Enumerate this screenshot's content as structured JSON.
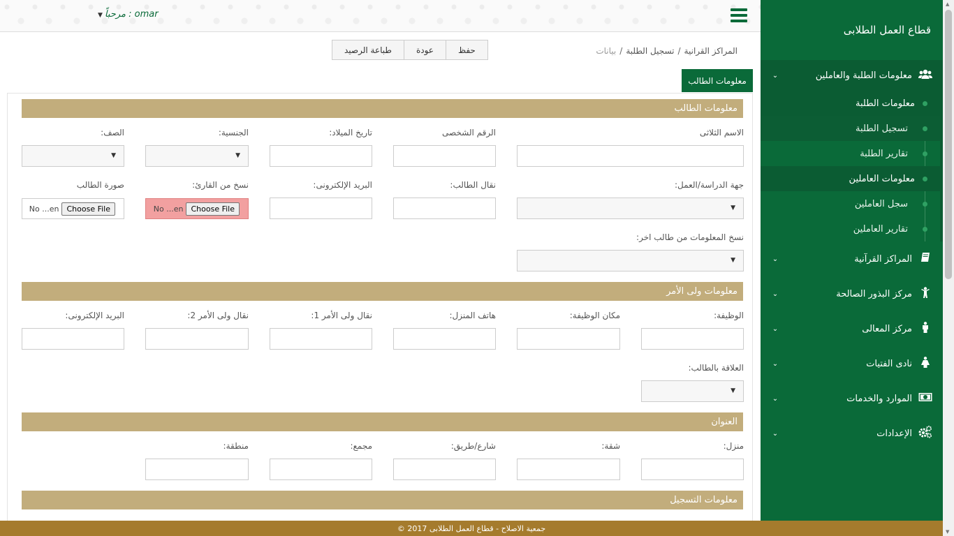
{
  "sidebar": {
    "title": "قطاع العمل الطلابى",
    "group_open": {
      "label": "معلومات الطلبة والعاملين",
      "icon": "users-icon"
    },
    "submenu": [
      {
        "type": "head",
        "label": "معلومات الطلبة"
      },
      {
        "type": "item",
        "label": "تسجيل الطلبة",
        "active": true
      },
      {
        "type": "item",
        "label": "تقارير الطلبة"
      },
      {
        "type": "head",
        "label": "معلومات العاملين"
      },
      {
        "type": "item",
        "label": "سجل العاملين"
      },
      {
        "type": "item",
        "label": "تقارير العاملين"
      }
    ],
    "items": [
      {
        "label": "المراكز القرآنية",
        "icon": "book-icon"
      },
      {
        "label": "مركز البذور الصالحة",
        "icon": "child-icon"
      },
      {
        "label": "مركز المعالى",
        "icon": "male-icon"
      },
      {
        "label": "نادى الفتيات",
        "icon": "female-icon"
      },
      {
        "label": "الموارد والخدمات",
        "icon": "money-icon"
      },
      {
        "label": "الإعدادات",
        "icon": "cogs-icon"
      }
    ]
  },
  "topbar": {
    "welcome": "مرحباً : omar"
  },
  "breadcrumb": {
    "part1": "المراكز القرانية",
    "sep1": "/",
    "part2": "تسجيل الطلبة",
    "sep2": "/",
    "current": "بيانات"
  },
  "toolbar": {
    "save": "حفظ",
    "back": "عودة",
    "print": "طباعة الرصيد"
  },
  "tab": {
    "label": "معلومات الطالب"
  },
  "sections": {
    "student": "معلومات الطالب",
    "guardian": "معلومات ولى الأمر",
    "address": "العنوان",
    "registration": "معلومات التسجيل"
  },
  "student_fields": {
    "full_name": "الاسم الثلاثى",
    "national_id": "الرقم الشخصى",
    "birth_date": "تاريخ الميلاد:",
    "nationality": "الجنسية:",
    "grade": "الصف:",
    "study_place": "جهة الدراسة/العمل:",
    "mobile": "نقال الطالب:",
    "email": "البريد الإلكترونى:",
    "reader_copy": "نسخ من القارئ:",
    "photo": "صورة الطالب",
    "copy_from": "نسخ المعلومات من طالب اخر:",
    "file_button": "Choose File",
    "file_status": "No ...en"
  },
  "guardian_fields": {
    "job": "الوظيفة:",
    "job_place": "مكان الوظيفة:",
    "home_phone": "هاتف المنزل:",
    "mobile1": "نقال ولى الأمر 1:",
    "mobile2": "نقال ولى الأمر 2:",
    "email": "البريد الإلكترونى:",
    "relation": "العلاقة بالطالب:"
  },
  "address_fields": {
    "house": "منزل:",
    "flat": "شقة:",
    "street": "شارع/طريق:",
    "block": "مجمع:",
    "area": "منطقة:"
  },
  "footer": {
    "text": "© 2017 جمعية الاصلاح - قطاع العمل الطلابى"
  },
  "colors": {
    "primary": "#0a6a39",
    "section": "#c2ad7c",
    "footer": "#a57b2d",
    "error": "#f2a0a0"
  }
}
